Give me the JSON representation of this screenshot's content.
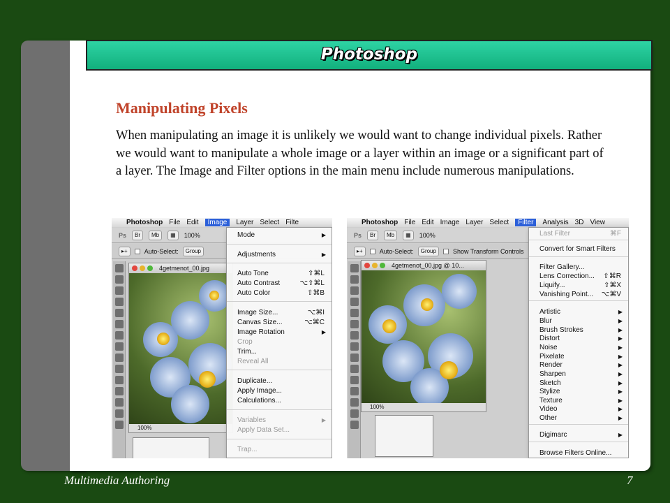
{
  "slide": {
    "title": "Photoshop",
    "heading": "Manipulating Pixels",
    "body": "When manipulating an image it is unlikely we would want to change individual pixels. Rather we would want to manipulate a whole image or a layer within an image or a significant part of a layer. The Image and Filter options in the main menu include numerous manipulations.",
    "footer_left": "Multimedia Authoring",
    "page_number": "7"
  },
  "colors": {
    "background": "#1a4a12",
    "title_bar": "#12b07d",
    "heading": "#c0432a",
    "menu_highlight": "#2b5fd9"
  },
  "shot1": {
    "menubar": [
      "Photoshop",
      "File",
      "Edit",
      "Image",
      "Layer",
      "Select",
      "Filte"
    ],
    "selected_menu": "Image",
    "zoom_toolbar": "100%",
    "auto_select": "Auto-Select:",
    "group_value": "Group",
    "doc_title": "4getmenot_00.jpg",
    "doc_zoom": "100%",
    "menu": [
      {
        "label": "Mode",
        "shortcut": "",
        "arrow": true,
        "disabled": false
      },
      {
        "label": "Adjustments",
        "shortcut": "",
        "arrow": true,
        "disabled": false
      },
      {
        "label": "Auto Tone",
        "shortcut": "⇧⌘L",
        "arrow": false,
        "disabled": false
      },
      {
        "label": "Auto Contrast",
        "shortcut": "⌥⇧⌘L",
        "arrow": false,
        "disabled": false
      },
      {
        "label": "Auto Color",
        "shortcut": "⇧⌘B",
        "arrow": false,
        "disabled": false
      },
      {
        "label": "Image Size...",
        "shortcut": "⌥⌘I",
        "arrow": false,
        "disabled": false
      },
      {
        "label": "Canvas Size...",
        "shortcut": "⌥⌘C",
        "arrow": false,
        "disabled": false
      },
      {
        "label": "Image Rotation",
        "shortcut": "",
        "arrow": true,
        "disabled": false
      },
      {
        "label": "Crop",
        "shortcut": "",
        "arrow": false,
        "disabled": true
      },
      {
        "label": "Trim...",
        "shortcut": "",
        "arrow": false,
        "disabled": false
      },
      {
        "label": "Reveal All",
        "shortcut": "",
        "arrow": false,
        "disabled": true
      },
      {
        "label": "Duplicate...",
        "shortcut": "",
        "arrow": false,
        "disabled": false
      },
      {
        "label": "Apply Image...",
        "shortcut": "",
        "arrow": false,
        "disabled": false
      },
      {
        "label": "Calculations...",
        "shortcut": "",
        "arrow": false,
        "disabled": false
      },
      {
        "label": "Variables",
        "shortcut": "",
        "arrow": true,
        "disabled": true
      },
      {
        "label": "Apply Data Set...",
        "shortcut": "",
        "arrow": false,
        "disabled": true
      },
      {
        "label": "Trap...",
        "shortcut": "",
        "arrow": false,
        "disabled": true
      }
    ]
  },
  "shot2": {
    "menubar": [
      "Photoshop",
      "File",
      "Edit",
      "Image",
      "Layer",
      "Select",
      "Filter",
      "Analysis",
      "3D",
      "View"
    ],
    "selected_menu": "Filter",
    "zoom_toolbar": "100%",
    "auto_select": "Auto-Select:",
    "group_value": "Group",
    "show_transform": "Show Transform Controls",
    "doc_title": "4getmenot_00.jpg @ 10...",
    "doc_zoom": "100%",
    "menu": [
      {
        "label": "Last Filter",
        "shortcut": "⌘F",
        "arrow": false,
        "disabled": true
      },
      {
        "label": "Convert for Smart Filters",
        "shortcut": "",
        "arrow": false,
        "disabled": false
      },
      {
        "label": "Filter Gallery...",
        "shortcut": "",
        "arrow": false,
        "disabled": false
      },
      {
        "label": "Lens Correction...",
        "shortcut": "⇧⌘R",
        "arrow": false,
        "disabled": false
      },
      {
        "label": "Liquify...",
        "shortcut": "⇧⌘X",
        "arrow": false,
        "disabled": false
      },
      {
        "label": "Vanishing Point...",
        "shortcut": "⌥⌘V",
        "arrow": false,
        "disabled": false
      },
      {
        "label": "Artistic",
        "shortcut": "",
        "arrow": true,
        "disabled": false
      },
      {
        "label": "Blur",
        "shortcut": "",
        "arrow": true,
        "disabled": false
      },
      {
        "label": "Brush Strokes",
        "shortcut": "",
        "arrow": true,
        "disabled": false
      },
      {
        "label": "Distort",
        "shortcut": "",
        "arrow": true,
        "disabled": false
      },
      {
        "label": "Noise",
        "shortcut": "",
        "arrow": true,
        "disabled": false
      },
      {
        "label": "Pixelate",
        "shortcut": "",
        "arrow": true,
        "disabled": false
      },
      {
        "label": "Render",
        "shortcut": "",
        "arrow": true,
        "disabled": false
      },
      {
        "label": "Sharpen",
        "shortcut": "",
        "arrow": true,
        "disabled": false
      },
      {
        "label": "Sketch",
        "shortcut": "",
        "arrow": true,
        "disabled": false
      },
      {
        "label": "Stylize",
        "shortcut": "",
        "arrow": true,
        "disabled": false
      },
      {
        "label": "Texture",
        "shortcut": "",
        "arrow": true,
        "disabled": false
      },
      {
        "label": "Video",
        "shortcut": "",
        "arrow": true,
        "disabled": false
      },
      {
        "label": "Other",
        "shortcut": "",
        "arrow": true,
        "disabled": false
      },
      {
        "label": "Digimarc",
        "shortcut": "",
        "arrow": true,
        "disabled": false
      },
      {
        "label": "Browse Filters Online...",
        "shortcut": "",
        "arrow": false,
        "disabled": false
      }
    ]
  }
}
